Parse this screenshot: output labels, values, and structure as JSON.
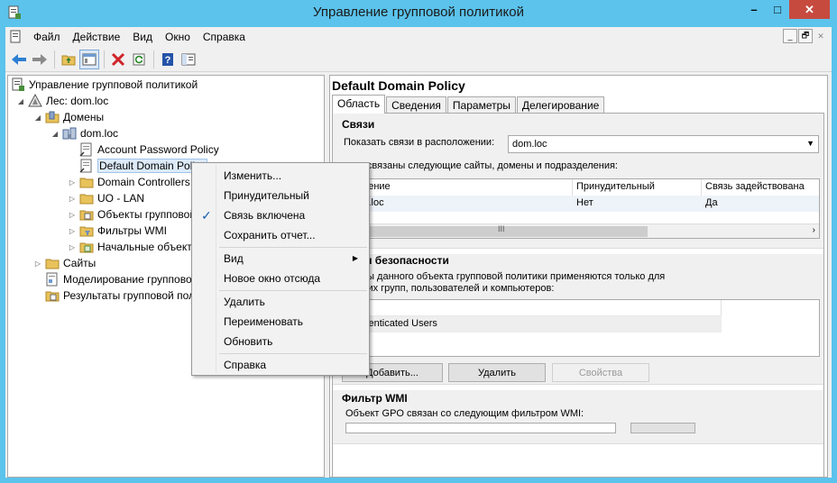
{
  "window": {
    "title": "Управление групповой политикой",
    "controls": {
      "minimize": "–",
      "maximize": "□",
      "close": "✕"
    }
  },
  "menubar": {
    "items": [
      "Файл",
      "Действие",
      "Вид",
      "Окно",
      "Справка"
    ],
    "mdi": {
      "minimize": "_",
      "restore": "🗗",
      "close": "✕"
    }
  },
  "toolbar": {
    "icons": [
      "back-arrow-icon",
      "forward-arrow-icon",
      "up-folder-icon",
      "show-tree-icon",
      "delete-icon",
      "refresh-icon",
      "help-icon",
      "properties-icon"
    ]
  },
  "tree": {
    "root": "Управление групповой политикой",
    "forest": "Лес: dom.loc",
    "domains": "Домены",
    "domain": "dom.loc",
    "items": [
      "Account Password Policy",
      "Default Domain Policy",
      "Domain Controllers",
      "UO - LAN",
      "Объекты групповой политики",
      "Фильтры WMI",
      "Начальные объекты групповой политики"
    ],
    "sites": "Сайты",
    "modeling": "Моделирование групповой политики",
    "results": "Результаты групповой политики"
  },
  "context_menu": {
    "items": [
      "Изменить...",
      "Принудительный",
      "Связь включена",
      "Сохранить отчет...",
      "Вид",
      "Новое окно отсюда",
      "Удалить",
      "Переименовать",
      "Обновить",
      "Справка"
    ],
    "checked": "Связь включена",
    "check_glyph": "✓",
    "submenu_glyph": "▶"
  },
  "right_pane": {
    "title": "Default Domain Policy",
    "tabs": [
      "Область",
      "Сведения",
      "Параметры",
      "Делегирование"
    ],
    "links": {
      "title": "Связи",
      "show_label": "Показать связи в расположении:",
      "location": "dom.loc",
      "description": "...ом связаны следующие сайты, домены и подразделения:",
      "columns": [
        "...ещение",
        "Принудительный",
        "Связь задействована"
      ],
      "rows": [
        {
          "location": "...om.loc",
          "enforced": "Нет",
          "enabled": "Да"
        }
      ],
      "scroll_grip": "III"
    },
    "security": {
      "title": "...тры безопасности",
      "description_line1": "...етры данного объекта групповой политики применяются только для",
      "description_line2": "...ющих групп, пользователей и компьютеров:",
      "entries": [
        "...uthenticated Users"
      ],
      "buttons": {
        "add": "Добавить...",
        "remove": "Удалить",
        "properties": "Свойства"
      }
    },
    "wmi": {
      "title": "Фильтр WMI",
      "description": "Объект GPO связан со следующим фильтром WMI:"
    }
  },
  "colors": {
    "titlebar": "#5bc3ec",
    "close_button": "#c74a3f",
    "selection": "#dceaf8",
    "check": "#1a5fb4"
  }
}
